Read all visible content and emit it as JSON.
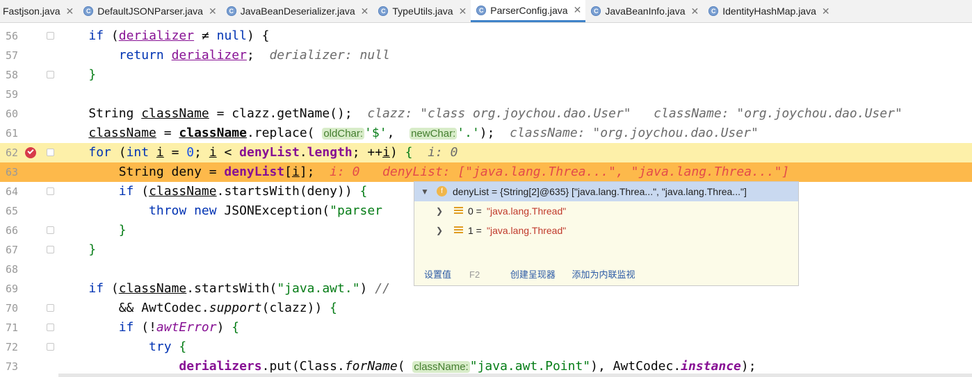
{
  "tabs": [
    {
      "label": "Fastjson.java",
      "active": false
    },
    {
      "label": "DefaultJSONParser.java",
      "active": false
    },
    {
      "label": "JavaBeanDeserializer.java",
      "active": false
    },
    {
      "label": "TypeUtils.java",
      "active": false
    },
    {
      "label": "ParserConfig.java",
      "active": true
    },
    {
      "label": "JavaBeanInfo.java",
      "active": false
    },
    {
      "label": "IdentityHashMap.java",
      "active": false
    }
  ],
  "lines": {
    "l56": {
      "num": "56",
      "derializer": "derializer",
      "hint": ""
    },
    "l57": {
      "num": "57",
      "derializer": "derializer",
      "hint": "derializer: null"
    },
    "l58": {
      "num": "58"
    },
    "l59": {
      "num": "59"
    },
    "l60": {
      "num": "60",
      "hint1": "clazz: \"class org.joychou.dao.User\"",
      "hint2": "className: \"org.joychou.dao.User\""
    },
    "l61": {
      "num": "61",
      "inlay1": "oldChar:",
      "arg1": "'$'",
      "inlay2": "newChar:",
      "arg2": "'.'",
      "hint": "className: \"org.joychou.dao.User\""
    },
    "l62": {
      "num": "62",
      "hint": "i: 0"
    },
    "l63": {
      "num": "63",
      "hint1": "i: 0",
      "hint2": "denyList: [\"java.lang.Threa...\", \"java.lang.Threa...\"]"
    },
    "l64": {
      "num": "64"
    },
    "l65": {
      "num": "65",
      "str": "\"parser"
    },
    "l66": {
      "num": "66"
    },
    "l67": {
      "num": "67"
    },
    "l68": {
      "num": "68"
    },
    "l69": {
      "num": "69",
      "str": "\"java.awt.\"",
      "comment": "//"
    },
    "l70": {
      "num": "70"
    },
    "l71": {
      "num": "71"
    },
    "l72": {
      "num": "72"
    },
    "l73": {
      "num": "73",
      "inlay": "className:",
      "str": "\"java.awt.Point\""
    }
  },
  "popup": {
    "root": "denyList = {String[2]@635} [\"java.lang.Threa...\", \"java.lang.Threa...\"]",
    "items": [
      {
        "index": "0 =",
        "value": "\"java.lang.Thread\""
      },
      {
        "index": "1 =",
        "value": "\"java.lang.Thread\""
      }
    ],
    "footer": {
      "set_value": "设置值",
      "set_value_key": "F2",
      "create_renderer": "创建呈现器",
      "add_inline_watch": "添加为内联监视"
    }
  },
  "colors": {
    "current_line": "#fdb94b",
    "breakpoint_line": "#fdf0a9",
    "breakpoint": "#d73a4a"
  }
}
